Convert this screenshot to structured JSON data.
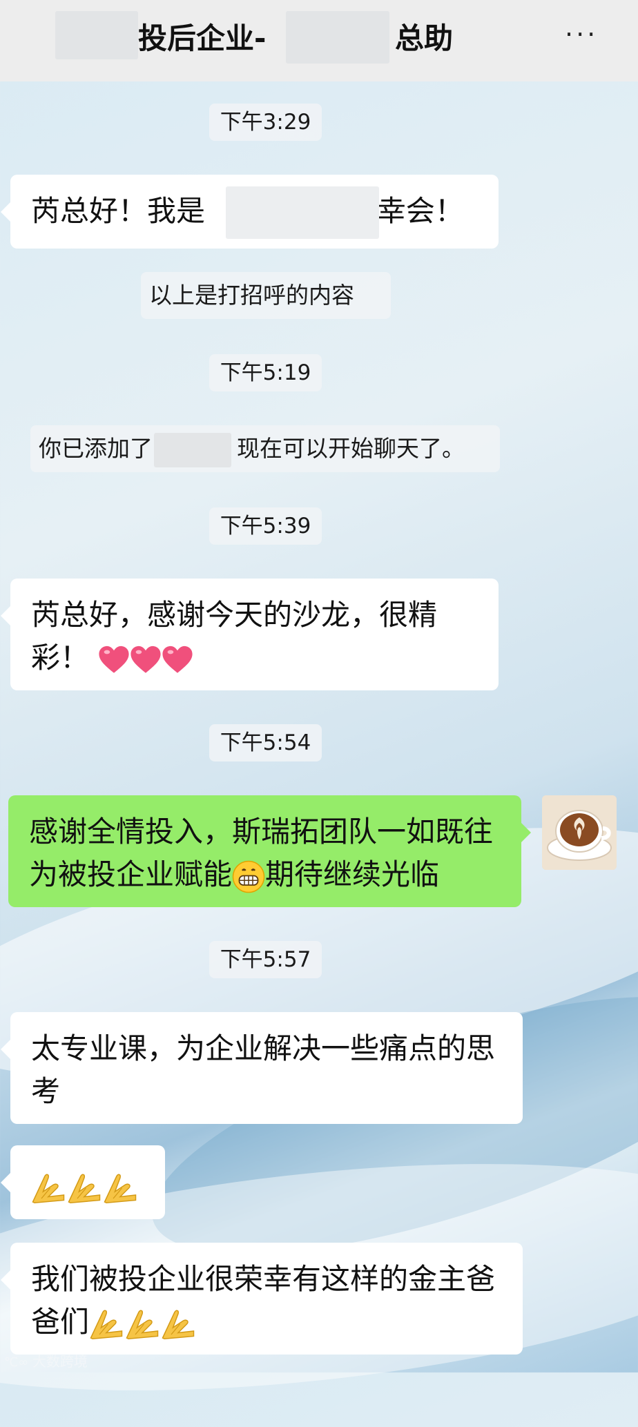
{
  "header": {
    "title_left": "投后企业-",
    "title_right": "总助",
    "more_label": "···"
  },
  "messages": {
    "time1": "下午3:29",
    "msg1_prefix": "芮总好！我是",
    "msg1_suffix": "幸会！",
    "sys1": "以上是打招呼的内容",
    "time2": "下午5:19",
    "sys2_prefix": "你已添加了",
    "sys2_suffix": "现在可以开始聊天了。",
    "time3": "下午5:39",
    "msg2": "芮总好，感谢今天的沙龙，很精彩！",
    "time4": "下午5:54",
    "msg3_part1": "感谢全情投入，斯瑞拓团队一如既往为被投企业赋能",
    "msg3_part2": "期待继续光临",
    "time5": "下午5:57",
    "msg4": "太专业课，为企业解决一些痛点的思考",
    "msg6": "我们被投企业很荣幸有这样的金主爸爸们"
  },
  "icons": {
    "heart": "heart-icon",
    "grin": "grinning-face-icon",
    "pray": "folded-hands-icon",
    "avatar": "coffee-latte-avatar"
  },
  "colors": {
    "header_bg": "#ededed",
    "bubble_white": "#ffffff",
    "bubble_green": "#95ec69",
    "heart": "#f0507c"
  },
  "watermark": "大数跨境"
}
